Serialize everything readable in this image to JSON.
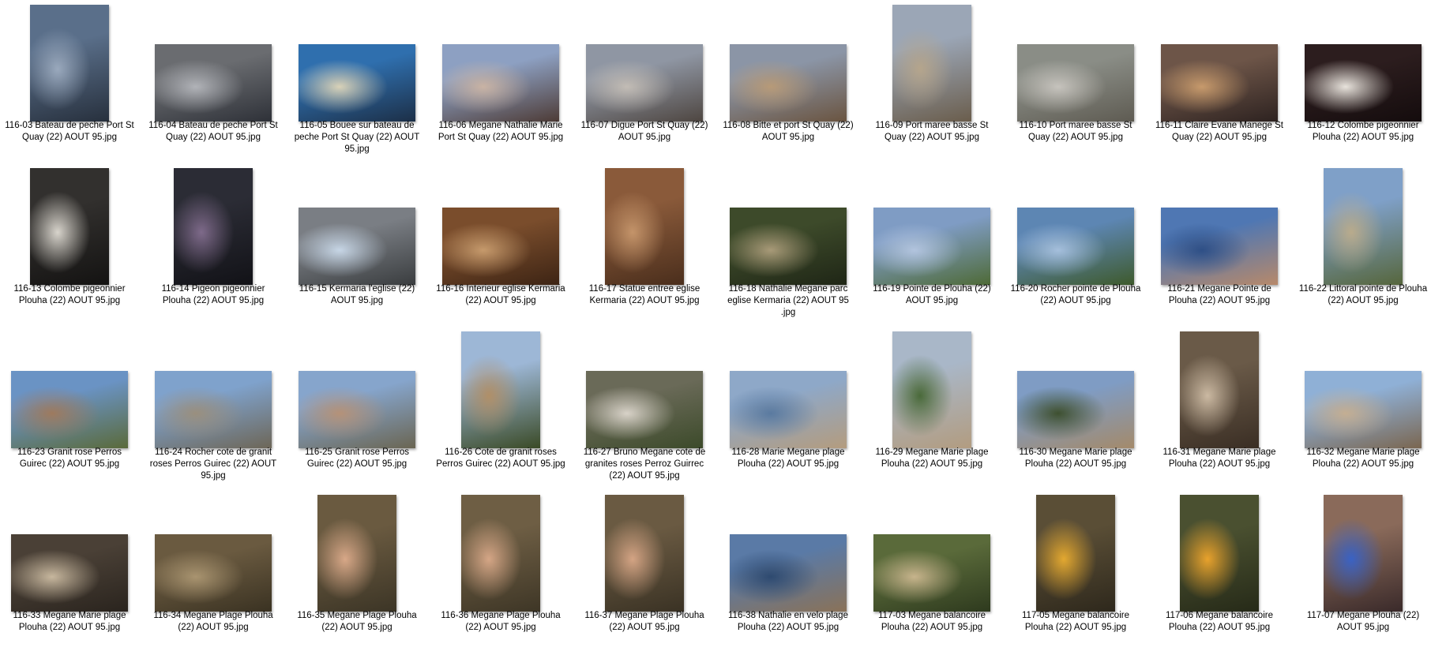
{
  "view": "large-icons",
  "files": [
    {
      "name": "116-03 Bateau de peche Port St Quay (22) AOUT 95.jpg",
      "orientation": "portrait",
      "colors": [
        "#5a6f8a",
        "#27303d",
        "#9aa9bd"
      ]
    },
    {
      "name": "116-04 Bateau de peche Port St Quay (22) AOUT 95.jpg",
      "orientation": "landscape",
      "colors": [
        "#6a6c70",
        "#2e3138",
        "#b1b3b8"
      ]
    },
    {
      "name": "116-05 Bouee sur bateau de peche Port St Quay (22) AOUT 95.jpg",
      "orientation": "landscape",
      "colors": [
        "#2f6fae",
        "#1c2f47",
        "#d9d2b8"
      ]
    },
    {
      "name": "116-06 Megane Nathalie Marie Port St Quay (22) AOUT 95.jpg",
      "orientation": "landscape",
      "colors": [
        "#8da0c2",
        "#4d3b36",
        "#c9b3a4"
      ]
    },
    {
      "name": "116-07 Digue Port St Quay (22) AOUT 95.jpg",
      "orientation": "landscape",
      "colors": [
        "#8f96a3",
        "#4e4641",
        "#c2bcb5"
      ]
    },
    {
      "name": "116-08 Bitte et port St Quay (22) AOUT 95.jpg",
      "orientation": "landscape",
      "colors": [
        "#8b95a6",
        "#6a5440",
        "#b79a78"
      ]
    },
    {
      "name": "116-09 Port maree basse St Quay (22) AOUT 95.jpg",
      "orientation": "portrait",
      "colors": [
        "#9ba6b6",
        "#6a5d4c",
        "#b5a58c"
      ]
    },
    {
      "name": "116-10 Port maree basse St Quay (22) AOUT 95.jpg",
      "orientation": "landscape",
      "colors": [
        "#8a8d86",
        "#5e5b52",
        "#c6c3bd"
      ]
    },
    {
      "name": "116-11 Claire Evane Manege St Quay (22) AOUT 95.jpg",
      "orientation": "landscape",
      "colors": [
        "#6d5548",
        "#2d2220",
        "#c79a6c"
      ]
    },
    {
      "name": "116-12 Colombe pigeonnier Plouha (22) AOUT 95.jpg",
      "orientation": "landscape",
      "colors": [
        "#2c1d1e",
        "#140c0d",
        "#e8e3dc"
      ]
    },
    {
      "name": "116-13 Colombe pigeonnier Plouha (22) AOUT 95.jpg",
      "orientation": "portrait",
      "colors": [
        "#32302e",
        "#141312",
        "#d8d4cc"
      ]
    },
    {
      "name": "116-14 Pigeon pigeonnier Plouha (22) AOUT 95.jpg",
      "orientation": "portrait",
      "colors": [
        "#2b2c35",
        "#121217",
        "#7e6a8a"
      ]
    },
    {
      "name": "116-15 Kermaria l'eglise (22) AOUT 95.jpg",
      "orientation": "landscape",
      "colors": [
        "#7a7e84",
        "#3a3d3f",
        "#c7d6e6"
      ]
    },
    {
      "name": "116-16 Interieur eglise Kermaria (22) AOUT 95.jpg",
      "orientation": "landscape",
      "colors": [
        "#7a4d2c",
        "#3d2414",
        "#c69a6c"
      ]
    },
    {
      "name": "116-17 Statue entree eglise Kermaria (22) AOUT 95.jpg",
      "orientation": "portrait",
      "colors": [
        "#8a5a3a",
        "#4a2e1c",
        "#c4946a"
      ]
    },
    {
      "name": "116-18 Nathalie Megane parc eglise Kermaria (22) AOUT 95 .jpg",
      "orientation": "landscape",
      "colors": [
        "#3d4a2a",
        "#1f2616",
        "#a89a78"
      ]
    },
    {
      "name": "116-19 Pointe de Plouha (22) AOUT 95.jpg",
      "orientation": "landscape",
      "colors": [
        "#7f9cc4",
        "#4e6a36",
        "#b2c4de"
      ]
    },
    {
      "name": "116-20 Rocher pointe de Plouha (22) AOUT 95.jpg",
      "orientation": "landscape",
      "colors": [
        "#5d86b3",
        "#3e5a2c",
        "#a5bfdc"
      ]
    },
    {
      "name": "116-21 Megane Pointe de Plouha (22) AOUT 95.jpg",
      "orientation": "landscape",
      "colors": [
        "#4f77b3",
        "#b7896a",
        "#2e4f86"
      ]
    },
    {
      "name": "116-22 Littoral pointe de Plouha (22) AOUT 95.jpg",
      "orientation": "portrait",
      "colors": [
        "#7fa0c8",
        "#56663c",
        "#b9ab8c"
      ]
    },
    {
      "name": "116-23 Granit rose Perros Guirec (22) AOUT 95.jpg",
      "orientation": "landscape",
      "colors": [
        "#6a93c4",
        "#5a6a3a",
        "#9e7a5e"
      ]
    },
    {
      "name": "116-24 Rocher cote de granit roses Perros Guirec (22) AOUT 95.jpg",
      "orientation": "landscape",
      "colors": [
        "#7fa2cc",
        "#6d6657",
        "#9a8f7e"
      ]
    },
    {
      "name": "116-25 Granit rose Perros Guirec (22) AOUT 95.jpg",
      "orientation": "landscape",
      "colors": [
        "#86a5cc",
        "#6a6552",
        "#b59278"
      ]
    },
    {
      "name": "116-26 Cote de granit roses Perros Guirec (22) AOUT 95.jpg",
      "orientation": "portrait",
      "colors": [
        "#9db7d6",
        "#3a4a26",
        "#b08f68"
      ]
    },
    {
      "name": "116-27 Bruno Megane cote de granites roses Perroz Guirrec (22) AOUT 95.jpg",
      "orientation": "landscape",
      "colors": [
        "#6a6a58",
        "#3c4a2a",
        "#d8d2c8"
      ]
    },
    {
      "name": "116-28 Marie Megane plage Plouha (22) AOUT 95.jpg",
      "orientation": "landscape",
      "colors": [
        "#8ea8c8",
        "#b49c7e",
        "#5a7aa0"
      ]
    },
    {
      "name": "116-29 Megane Marie plage Plouha (22) AOUT 95.jpg",
      "orientation": "portrait",
      "colors": [
        "#a9b7c8",
        "#b29c80",
        "#4a6a3a"
      ]
    },
    {
      "name": "116-30 Megane Marie plage Plouha (22) AOUT 95.jpg",
      "orientation": "landscape",
      "colors": [
        "#7f9cc4",
        "#a48a6a",
        "#3e5030"
      ]
    },
    {
      "name": "116-31 Megane Marie plage Plouha (22) AOUT 95.jpg",
      "orientation": "portrait",
      "colors": [
        "#6a5a48",
        "#3a2e24",
        "#cbb9a2"
      ]
    },
    {
      "name": "116-32 Megane Marie plage Plouha (22) AOUT 95.jpg",
      "orientation": "landscape",
      "colors": [
        "#8fb0d6",
        "#7a6650",
        "#c4ae92"
      ]
    },
    {
      "name": "116-33 Megane Marie plage Plouha (22) AOUT 95.jpg",
      "orientation": "landscape",
      "colors": [
        "#4a4036",
        "#2a241e",
        "#c7b79e"
      ]
    },
    {
      "name": "116-34 Megane Plage Plouha (22) AOUT 95.jpg",
      "orientation": "landscape",
      "colors": [
        "#6a5a40",
        "#3a3222",
        "#a99470"
      ]
    },
    {
      "name": "116-35 Megane Plage Plouha (22) AOUT 95.jpg",
      "orientation": "portrait",
      "colors": [
        "#6a5a40",
        "#3c3526",
        "#d8a888"
      ]
    },
    {
      "name": "116-36 Megane Plage Plouha (22) AOUT 95.jpg",
      "orientation": "portrait",
      "colors": [
        "#6e5e44",
        "#3e3626",
        "#d5a686"
      ]
    },
    {
      "name": "116-37 Megane Plage Plouha (22) AOUT 95.jpg",
      "orientation": "portrait",
      "colors": [
        "#6a5a42",
        "#3a3224",
        "#d4a484"
      ]
    },
    {
      "name": "116-38 Nathalie en velo plage Plouha (22) AOUT 95.jpg",
      "orientation": "landscape",
      "colors": [
        "#5a7aa6",
        "#8a7258",
        "#2e4a70"
      ]
    },
    {
      "name": "117-03 Megane balancoire Plouha (22) AOUT 95.jpg",
      "orientation": "landscape",
      "colors": [
        "#5a6a3a",
        "#2e3a1e",
        "#c7b48c"
      ]
    },
    {
      "name": "117-05 Megane balancoire Plouha (22) AOUT 95.jpg",
      "orientation": "portrait",
      "colors": [
        "#5a4e36",
        "#2e281c",
        "#e3a830"
      ]
    },
    {
      "name": "117-06 Megane balancoire Plouha (22) AOUT 95.jpg",
      "orientation": "portrait",
      "colors": [
        "#4a5030",
        "#262a18",
        "#e8a22c"
      ]
    },
    {
      "name": "117-07 Megane Plouha (22) AOUT 95.jpg",
      "orientation": "portrait",
      "colors": [
        "#8a6a5a",
        "#3a2a2a",
        "#3a62c4"
      ]
    }
  ]
}
